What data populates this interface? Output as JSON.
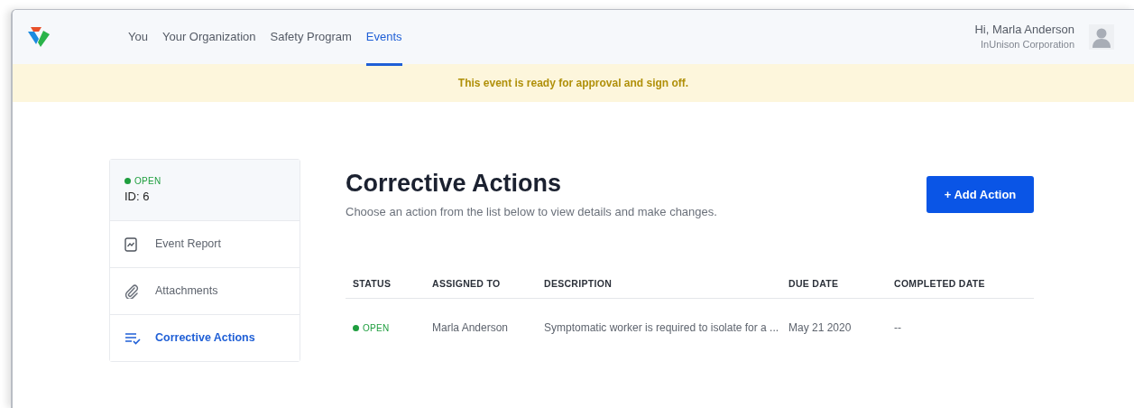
{
  "nav": {
    "tabs": [
      {
        "label": "You",
        "selected": false
      },
      {
        "label": "Your Organization",
        "selected": false
      },
      {
        "label": "Safety Program",
        "selected": false
      },
      {
        "label": "Events",
        "selected": true
      }
    ],
    "user": {
      "greeting": "Hi, Marla Anderson",
      "organization": "InUnison Corporation"
    }
  },
  "banner": "This event is ready for approval and sign off.",
  "sidebar": {
    "status": {
      "label": "OPEN",
      "color": "#1e9e3e"
    },
    "id": "ID: 6",
    "items": [
      {
        "label": "Event Report",
        "kind": "report",
        "selected": false
      },
      {
        "label": "Attachments",
        "kind": "attachment",
        "selected": false
      },
      {
        "label": "Corrective Actions",
        "kind": "checklist",
        "selected": true
      }
    ]
  },
  "main": {
    "title": "Corrective Actions",
    "subtitle": "Choose an action from the list below to view details and make changes.",
    "add_button": "+ Add Action",
    "table": {
      "columns": [
        "STATUS",
        "ASSIGNED TO",
        "DESCRIPTION",
        "DUE DATE",
        "COMPLETED DATE"
      ],
      "rows": [
        {
          "status": {
            "label": "OPEN",
            "color": "#1e9e3e"
          },
          "assigned_to": "Marla Anderson",
          "description": "Symptomatic worker is required to isolate for a ...",
          "due_date": "May 21 2020",
          "completed_date": "--"
        }
      ]
    }
  }
}
